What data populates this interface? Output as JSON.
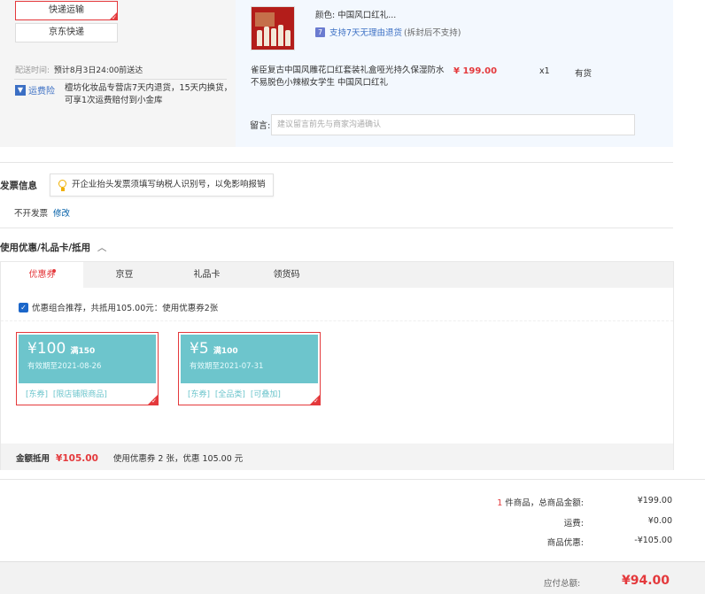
{
  "shipping": {
    "options": [
      {
        "label": "快递运输",
        "selected": true
      },
      {
        "label": "京东快递",
        "selected": false
      }
    ],
    "delivery_label": "配送时间:",
    "delivery_value": "预计8月3日24:00前送达",
    "insurance_label": "运费险",
    "insurance_desc": "檀坊化妆品专营店7天内退货，15天内换货，可享1次运费赔付到小金库"
  },
  "product": {
    "color_label": "颜色:",
    "color_value": "中国风口红礼...",
    "return_policy": "支持7天无理由退货",
    "return_note": "(拆封后不支持)",
    "return_badge": "7",
    "name": "雀臣复古中国风雕花口红套装礼盒哑光持久保湿防水不易脱色小辣椒女学生 中国风口红礼",
    "price": "¥ 199.00",
    "quantity": "x1",
    "stock": "有货",
    "message_label": "留言:",
    "message_placeholder": "建议留言前先与商家沟通确认"
  },
  "invoice": {
    "title": "发票信息",
    "tip": "开企业抬头发票须填写纳税人识别号，以免影响报销",
    "status": "不开发票",
    "edit_label": "修改"
  },
  "coupons": {
    "title": "使用优惠/礼品卡/抵用",
    "chevron": "︿",
    "tabs": [
      {
        "label": "优惠券",
        "active": true
      },
      {
        "label": "京豆",
        "active": false
      },
      {
        "label": "礼品卡",
        "active": false
      },
      {
        "label": "领货码",
        "active": false
      }
    ],
    "recommend_text": "优惠组合推荐，共抵用105.00元：使用优惠券2张",
    "items": [
      {
        "amount": "¥100",
        "condition": "满150",
        "expiry": "有效期至2021-08-26",
        "tags": [
          "[东券]",
          "[限店铺限商品]"
        ]
      },
      {
        "amount": "¥5",
        "condition": "满100",
        "expiry": "有效期至2021-07-31",
        "tags": [
          "[东券]",
          "[全品类]",
          "[可叠加]"
        ]
      }
    ],
    "summary_label": "金额抵用",
    "summary_amount": "¥105.00",
    "summary_desc": "使用优惠券 2 张，优惠 105.00 元"
  },
  "totals": {
    "count": "1",
    "count_suffix": " 件商品，总商品金额:",
    "goods_amount": "¥199.00",
    "shipping_label": "运费:",
    "shipping_amount": "¥0.00",
    "discount_label": "商品优惠:",
    "discount_amount": "-¥105.00",
    "payable_label": "应付总额:",
    "payable_amount": "¥94.00"
  },
  "colors": {
    "accent_red": "#e4393c",
    "coupon_teal": "#6dc5cc",
    "link_blue": "#005ea7"
  }
}
